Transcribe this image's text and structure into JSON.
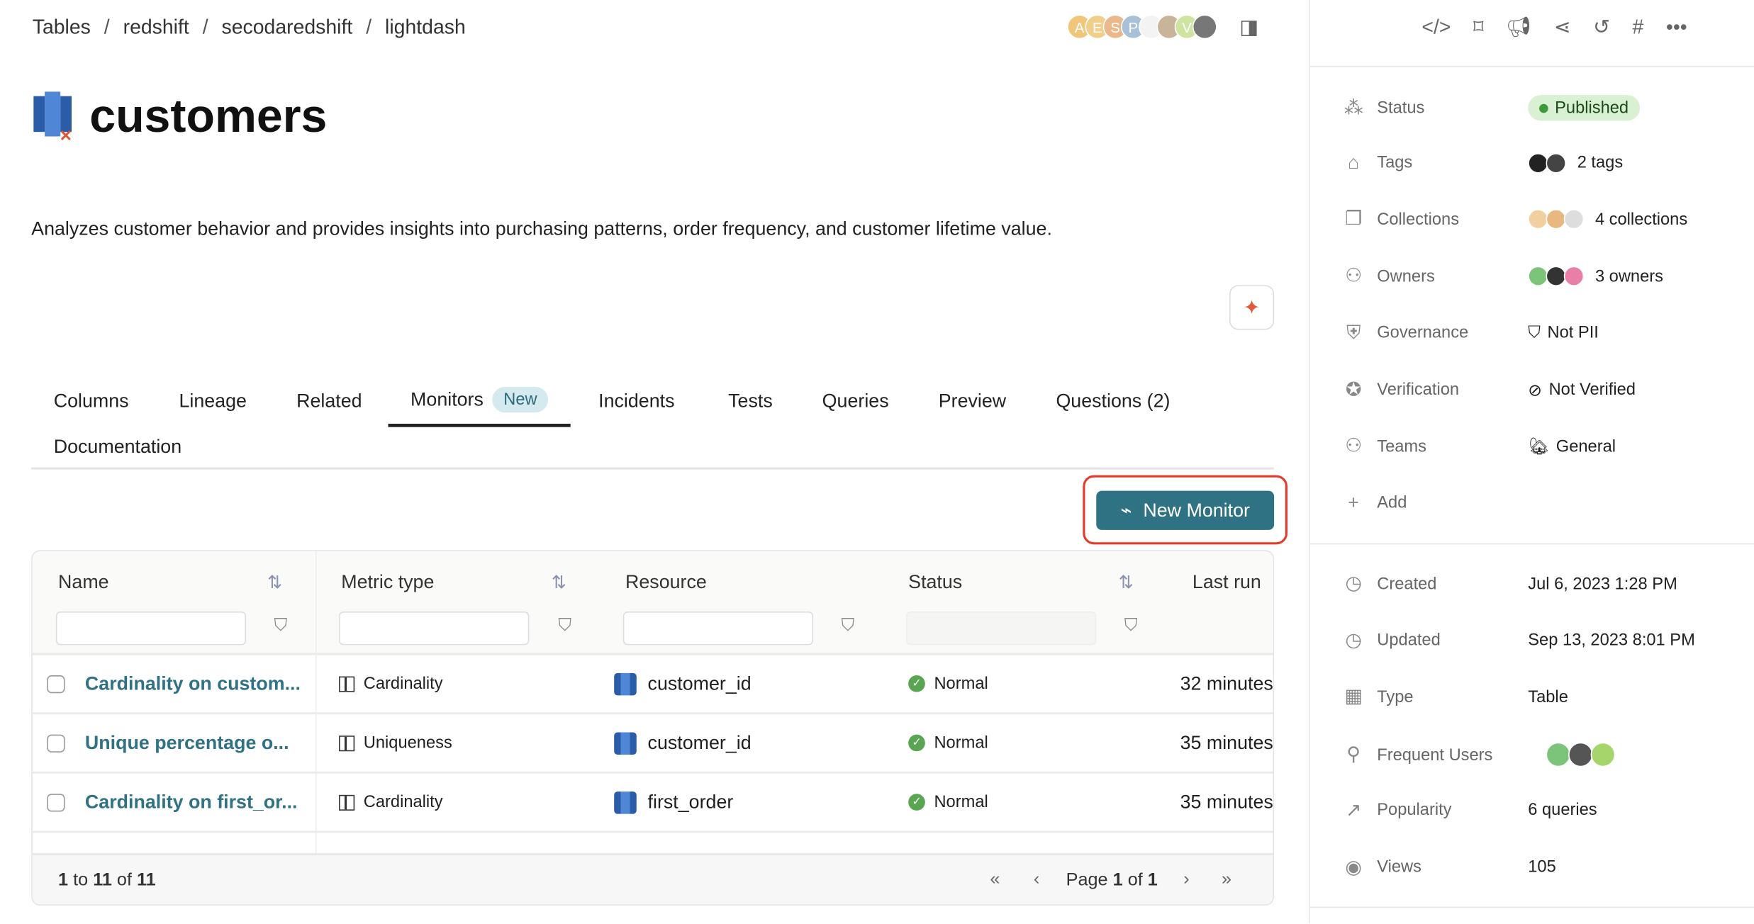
{
  "breadcrumb": [
    "Tables",
    "redshift",
    "secodaredshift",
    "lightdash"
  ],
  "header_avatars": [
    {
      "letter": "A",
      "color": "#f0c77a"
    },
    {
      "letter": "E",
      "color": "#f0cf8a"
    },
    {
      "letter": "S",
      "color": "#eab88a"
    },
    {
      "letter": "P",
      "color": "#a9c1d8"
    },
    {
      "letter": "",
      "color": "#f3f3f3"
    },
    {
      "letter": "",
      "color": "#c9b49a"
    },
    {
      "letter": "V",
      "color": "#cfe4a0"
    },
    {
      "letter": "",
      "color": "#777"
    }
  ],
  "title": "customers",
  "description": "Analyzes customer behavior and provides insights into purchasing patterns, order frequency, and customer lifetime value.",
  "tabs": [
    {
      "label": "Columns"
    },
    {
      "label": "Lineage"
    },
    {
      "label": "Related"
    },
    {
      "label": "Monitors",
      "badge": "New",
      "active": true
    },
    {
      "label": "Incidents"
    },
    {
      "label": "Tests"
    },
    {
      "label": "Queries"
    },
    {
      "label": "Preview"
    },
    {
      "label": "Questions (2)"
    },
    {
      "label": "Documentation"
    }
  ],
  "new_monitor_label": "New Monitor",
  "table": {
    "columns": [
      "Name",
      "Metric type",
      "Resource",
      "Status",
      "Last run"
    ],
    "rows": [
      {
        "name": "Cardinality on custom...",
        "metric": "Cardinality",
        "resource": "customer_id",
        "status": "Normal",
        "last_run": "32 minutes"
      },
      {
        "name": "Unique percentage o...",
        "metric": "Uniqueness",
        "resource": "customer_id",
        "status": "Normal",
        "last_run": "35 minutes"
      },
      {
        "name": "Cardinality on first_or...",
        "metric": "Cardinality",
        "resource": "first_order",
        "status": "Normal",
        "last_run": "35 minutes"
      }
    ],
    "footer": {
      "range_pre": "1",
      "to": "to",
      "range_end": "11",
      "of": "of",
      "total": "11",
      "page_label": "Page",
      "page": "1",
      "page_of": "of",
      "pages": "1"
    }
  },
  "sidebar": {
    "properties": [
      {
        "icon": "status-icon",
        "label": "Status",
        "value": "Published"
      },
      {
        "icon": "tag-icon",
        "label": "Tags",
        "value": "2 tags"
      },
      {
        "icon": "collection-icon",
        "label": "Collections",
        "value": "4 collections"
      },
      {
        "icon": "user-icon",
        "label": "Owners",
        "value": "3 owners"
      },
      {
        "icon": "shield-icon",
        "label": "Governance",
        "value": "Not PII"
      },
      {
        "icon": "verified-icon",
        "label": "Verification",
        "value": "Not Verified"
      },
      {
        "icon": "team-icon",
        "label": "Teams",
        "value": "General"
      },
      {
        "icon": "plus-icon",
        "label": "Add",
        "value": ""
      }
    ],
    "meta": [
      {
        "icon": "clock-icon",
        "label": "Created",
        "value": "Jul 6, 2023 1:28 PM"
      },
      {
        "icon": "clock-icon",
        "label": "Updated",
        "value": "Sep 13, 2023 8:01 PM"
      },
      {
        "icon": "grid-icon",
        "label": "Type",
        "value": "Table"
      },
      {
        "icon": "user-search-icon",
        "label": "Frequent Users",
        "value": ""
      },
      {
        "icon": "trend-icon",
        "label": "Popularity",
        "value": "6 queries"
      },
      {
        "icon": "eye-icon",
        "label": "Views",
        "value": "105"
      }
    ]
  },
  "colors": {
    "accent": "#2f7283",
    "highlight": "#e53b2c",
    "published_bg": "#d9f0d3",
    "normal": "#5aa552"
  }
}
